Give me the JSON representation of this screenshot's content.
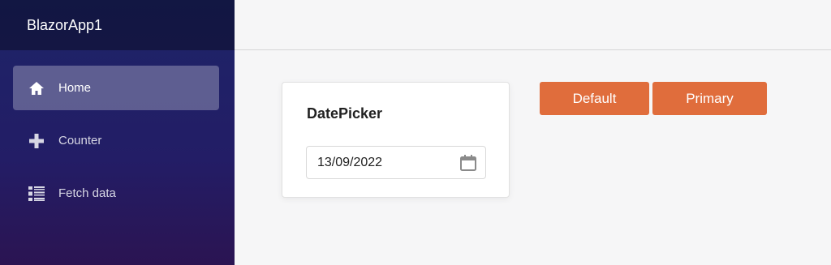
{
  "brand": {
    "title": "BlazorApp1"
  },
  "sidebar": {
    "items": [
      {
        "label": "Home",
        "icon": "home-icon",
        "active": true
      },
      {
        "label": "Counter",
        "icon": "plus-icon",
        "active": false
      },
      {
        "label": "Fetch data",
        "icon": "list-icon",
        "active": false
      }
    ]
  },
  "card": {
    "title": "DatePicker",
    "date_value": "13/09/2022"
  },
  "buttons": {
    "default_label": "Default",
    "primary_label": "Primary"
  },
  "colors": {
    "accent": "#e06d3c",
    "sidebar_top": "#1d2468",
    "sidebar_bottom": "#2b1452"
  }
}
